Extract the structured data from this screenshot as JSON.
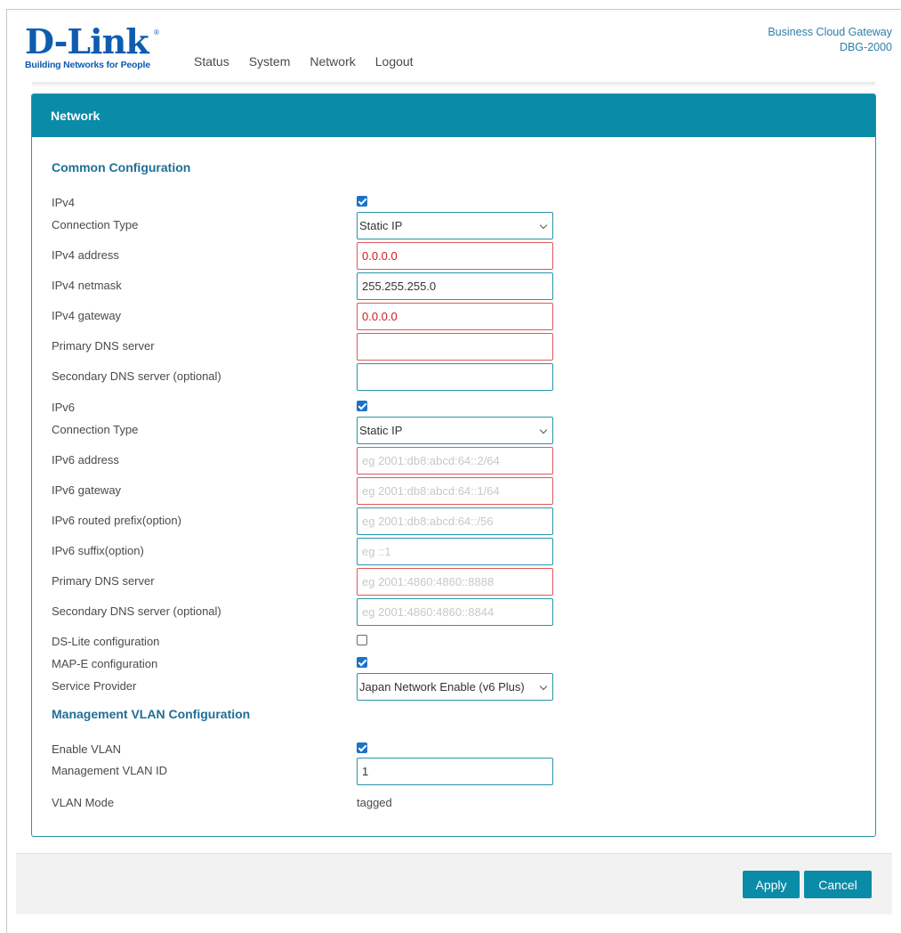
{
  "header": {
    "logo_text": "D-Link",
    "logo_tagline": "Building Networks for People",
    "nav": [
      "Status",
      "System",
      "Network",
      "Logout"
    ],
    "product_line": "Business Cloud Gateway",
    "model": "DBG-2000"
  },
  "panel": {
    "title": "Network",
    "common_title": "Common Configuration",
    "ipv4": {
      "label": "IPv4",
      "checked": true
    },
    "ipv4_connection_type": {
      "label": "Connection Type",
      "value": "Static IP"
    },
    "ipv4_address": {
      "label": "IPv4 address",
      "value": "0.0.0.0"
    },
    "ipv4_netmask": {
      "label": "IPv4 netmask",
      "value": "255.255.255.0"
    },
    "ipv4_gateway": {
      "label": "IPv4 gateway",
      "value": "0.0.0.0"
    },
    "ipv4_primary_dns": {
      "label": "Primary DNS server",
      "value": ""
    },
    "ipv4_secondary_dns": {
      "label": "Secondary DNS server (optional)",
      "value": ""
    },
    "ipv6": {
      "label": "IPv6",
      "checked": true
    },
    "ipv6_connection_type": {
      "label": "Connection Type",
      "value": "Static IP"
    },
    "ipv6_address": {
      "label": "IPv6 address",
      "placeholder": "eg 2001:db8:abcd:64::2/64"
    },
    "ipv6_gateway": {
      "label": "IPv6 gateway",
      "placeholder": "eg 2001:db8:abcd:64::1/64"
    },
    "ipv6_routed_prefix": {
      "label": "IPv6 routed prefix(option)",
      "placeholder": "eg 2001:db8:abcd:64::/56"
    },
    "ipv6_suffix": {
      "label": "IPv6 suffix(option)",
      "placeholder": "eg ::1"
    },
    "ipv6_primary_dns": {
      "label": "Primary DNS server",
      "placeholder": "eg 2001:4860:4860::8888"
    },
    "ipv6_secondary_dns": {
      "label": "Secondary DNS server (optional)",
      "placeholder": "eg 2001:4860:4860::8844"
    },
    "ds_lite": {
      "label": "DS-Lite configuration",
      "checked": false
    },
    "map_e": {
      "label": "MAP-E configuration",
      "checked": true
    },
    "service_provider": {
      "label": "Service Provider",
      "value": "Japan Network Enable (v6 Plus)"
    },
    "vlan_title": "Management VLAN Configuration",
    "enable_vlan": {
      "label": "Enable VLAN",
      "checked": true
    },
    "vlan_id": {
      "label": "Management VLAN ID",
      "value": "1"
    },
    "vlan_mode": {
      "label": "VLAN Mode",
      "value": "tagged"
    }
  },
  "footer": {
    "apply_label": "Apply",
    "cancel_label": "Cancel"
  },
  "colors": {
    "brand": "#0e5cb0",
    "accent": "#0a8ba7",
    "error": "#e05959",
    "checkbox": "#1a73c8"
  }
}
